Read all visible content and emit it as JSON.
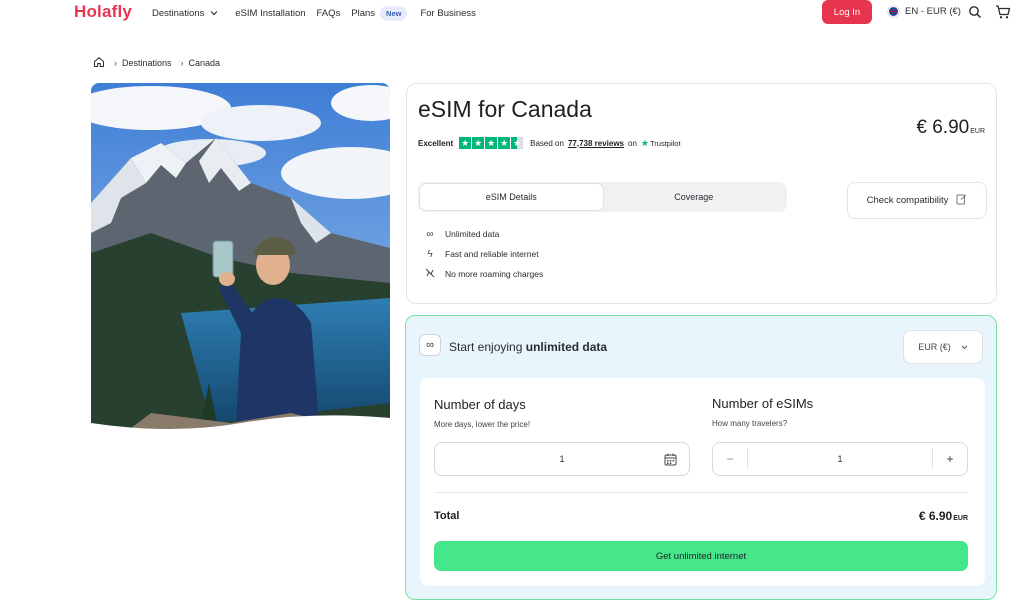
{
  "header": {
    "logo": "Holafly",
    "nav": {
      "destinations": "Destinations",
      "esim_installation": "eSIM Installation",
      "faqs": "FAQs",
      "plans": "Plans",
      "plans_badge": "New",
      "for_business": "For Business"
    },
    "login_label": "Log In",
    "language_label": "EN - EUR (€)"
  },
  "breadcrumb": {
    "items": [
      "Destinations",
      "Canada"
    ]
  },
  "product": {
    "title": "eSIM for Canada",
    "price": "€ 6.90",
    "price_currency": "EUR",
    "rating_label": "Excellent",
    "rating_stars": 4.5,
    "based_on": "Based on",
    "reviews_count": "77,738 reviews",
    "on": "on",
    "trustpilot": "Trustpilot",
    "tabs": [
      "eSIM Details",
      "Coverage"
    ],
    "check_compat_label": "Check compatibility",
    "features": [
      "Unlimited data",
      "Fast and reliable internet",
      "No more roaming charges"
    ]
  },
  "purchase": {
    "header_prefix": "Start enjoying",
    "header_bold": "unlimited data",
    "currency_select": "EUR (€)",
    "days_label": "Number of days",
    "days_sub": "More days, lower the price!",
    "days_value": "1",
    "esims_label": "Number of eSIMs",
    "esims_sub": "How many travelers?",
    "esims_value": "1",
    "total_label": "Total",
    "total_price": "€ 6.90",
    "total_currency": "EUR",
    "cta_label": "Get unlimited internet"
  },
  "colors": {
    "brand": "#e8354f",
    "cta_green": "#45e78a",
    "card_border_green": "#79e0a4",
    "trustpilot_green": "#00b67a"
  }
}
